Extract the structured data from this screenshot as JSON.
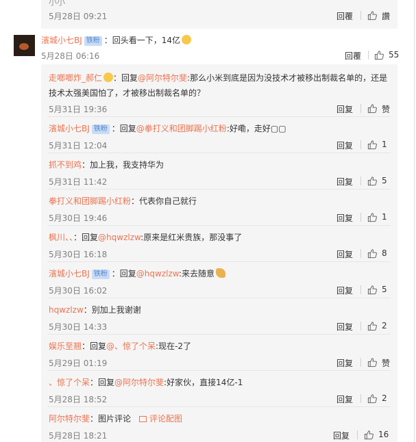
{
  "top": {
    "time": "5月28日 09:21",
    "reply": "回覆",
    "like": "讚",
    "cutoff": "小小"
  },
  "main": {
    "user": "濱城小七BJ",
    "badge": "铁粉",
    "text": "：回头看一下，14亿",
    "time": "5月28日 06:16",
    "reply": "回覆",
    "like": "55"
  },
  "replies": [
    {
      "user": "走啷啷炸_郝仁",
      "pre": "：回复",
      "mention": "@阿尔特尔斐",
      "text": ":那么小米到底是因为没技术才被移出制裁名单的，还是技术太强美国怕了，才被移出制裁名单的？",
      "time": "5月31日 19:36",
      "reply": "回复",
      "like": "赞"
    },
    {
      "user": "濱城小七BJ",
      "badge": "铁粉",
      "pre": "：回复",
      "mention": "@拳打义和团脚踢小红粉",
      "text": ":好嘞，走好▢▢",
      "time": "5月31日 12:04",
      "reply": "回复",
      "like": "1"
    },
    {
      "user": "抓不到鸡",
      "text": "：加上我，我支持华为",
      "time": "5月31日 11:42",
      "reply": "回复",
      "like": "5"
    },
    {
      "user": "拳打义和团脚踢小红粉",
      "text": "：代表你自己就行",
      "time": "5月30日 19:46",
      "reply": "回复",
      "like": "1"
    },
    {
      "user": "枫川、、",
      "pre": "：回复",
      "mention": "@hqwzlzw",
      "text": ":原来是红米贵族，那没事了",
      "time": "5月30日 16:18",
      "reply": "回复",
      "like": "8"
    },
    {
      "user": "濱城小七BJ",
      "badge": "铁粉",
      "pre": "：回复",
      "mention": "@hqwzlzw",
      "text": ":来去随意",
      "time": "5月30日 16:02",
      "reply": "回复",
      "like": "5"
    },
    {
      "user": "hqwzlzw",
      "text": "：别加上我谢谢",
      "time": "5月30日 14:33",
      "reply": "回复",
      "like": "2"
    },
    {
      "user": "娱乐至翘",
      "pre": "：回复",
      "mention": "@、惊了个呆",
      "text": ":现在-2了",
      "time": "5月29日 01:19",
      "reply": "回复",
      "like": "赞"
    },
    {
      "user": "、惊了个呆",
      "pre": "：回复",
      "mention": "@阿尔特尔斐",
      "text": ":好家伙，直接14亿-1",
      "time": "5月28日 18:52",
      "reply": "回复",
      "like": "2"
    },
    {
      "user": "阿尔特尔斐",
      "text": "：图片评论",
      "imgcomment": "评论配图",
      "time": "5月28日 18:21",
      "reply": "回复",
      "like": "16"
    }
  ],
  "colors": {
    "username": "#eb7350",
    "badge_bg": "#c8dcf7",
    "row_bg": "#f5f5f5"
  }
}
